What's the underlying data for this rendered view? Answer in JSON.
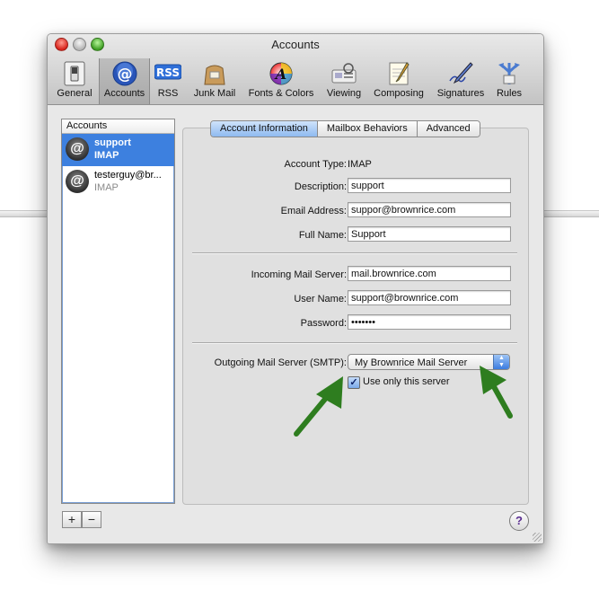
{
  "window": {
    "title": "Accounts"
  },
  "toolbar": {
    "items": [
      {
        "label": "General",
        "icon": "switch-icon"
      },
      {
        "label": "Accounts",
        "icon": "at-sign-icon"
      },
      {
        "label": "RSS",
        "icon": "rss-icon"
      },
      {
        "label": "Junk Mail",
        "icon": "junk-bag-icon"
      },
      {
        "label": "Fonts & Colors",
        "icon": "fonts-colors-icon"
      },
      {
        "label": "Viewing",
        "icon": "viewing-icon"
      },
      {
        "label": "Composing",
        "icon": "composing-icon"
      },
      {
        "label": "Signatures",
        "icon": "signature-pen-icon"
      },
      {
        "label": "Rules",
        "icon": "rules-icon"
      }
    ],
    "selected": "Accounts"
  },
  "accounts": {
    "header": "Accounts",
    "list": [
      {
        "name": "support",
        "type": "IMAP",
        "selected": true
      },
      {
        "name": "testerguy@br...",
        "type": "IMAP",
        "selected": false
      }
    ],
    "add_label": "+",
    "remove_label": "−"
  },
  "tabs": [
    {
      "label": "Account Information",
      "selected": true
    },
    {
      "label": "Mailbox Behaviors",
      "selected": false
    },
    {
      "label": "Advanced",
      "selected": false
    }
  ],
  "form": {
    "account_type_label": "Account Type:",
    "account_type_value": "IMAP",
    "description_label": "Description:",
    "description_value": "support",
    "email_label": "Email Address:",
    "email_value": "suppor@brownrice.com",
    "fullname_label": "Full Name:",
    "fullname_value": "Support",
    "incoming_label": "Incoming Mail Server:",
    "incoming_value": "mail.brownrice.com",
    "username_label": "User Name:",
    "username_value": "support@brownrice.com",
    "password_label": "Password:",
    "password_value": "•••••••",
    "smtp_label": "Outgoing Mail Server (SMTP):",
    "smtp_value": "My Brownrice Mail Server",
    "use_only_label": "Use only this server",
    "use_only_checked": true
  },
  "help_label": "?",
  "colors": {
    "selection": "#3d80df",
    "annotation_arrow": "#2e7d1f",
    "tab_selected": "#8fbaf0"
  }
}
